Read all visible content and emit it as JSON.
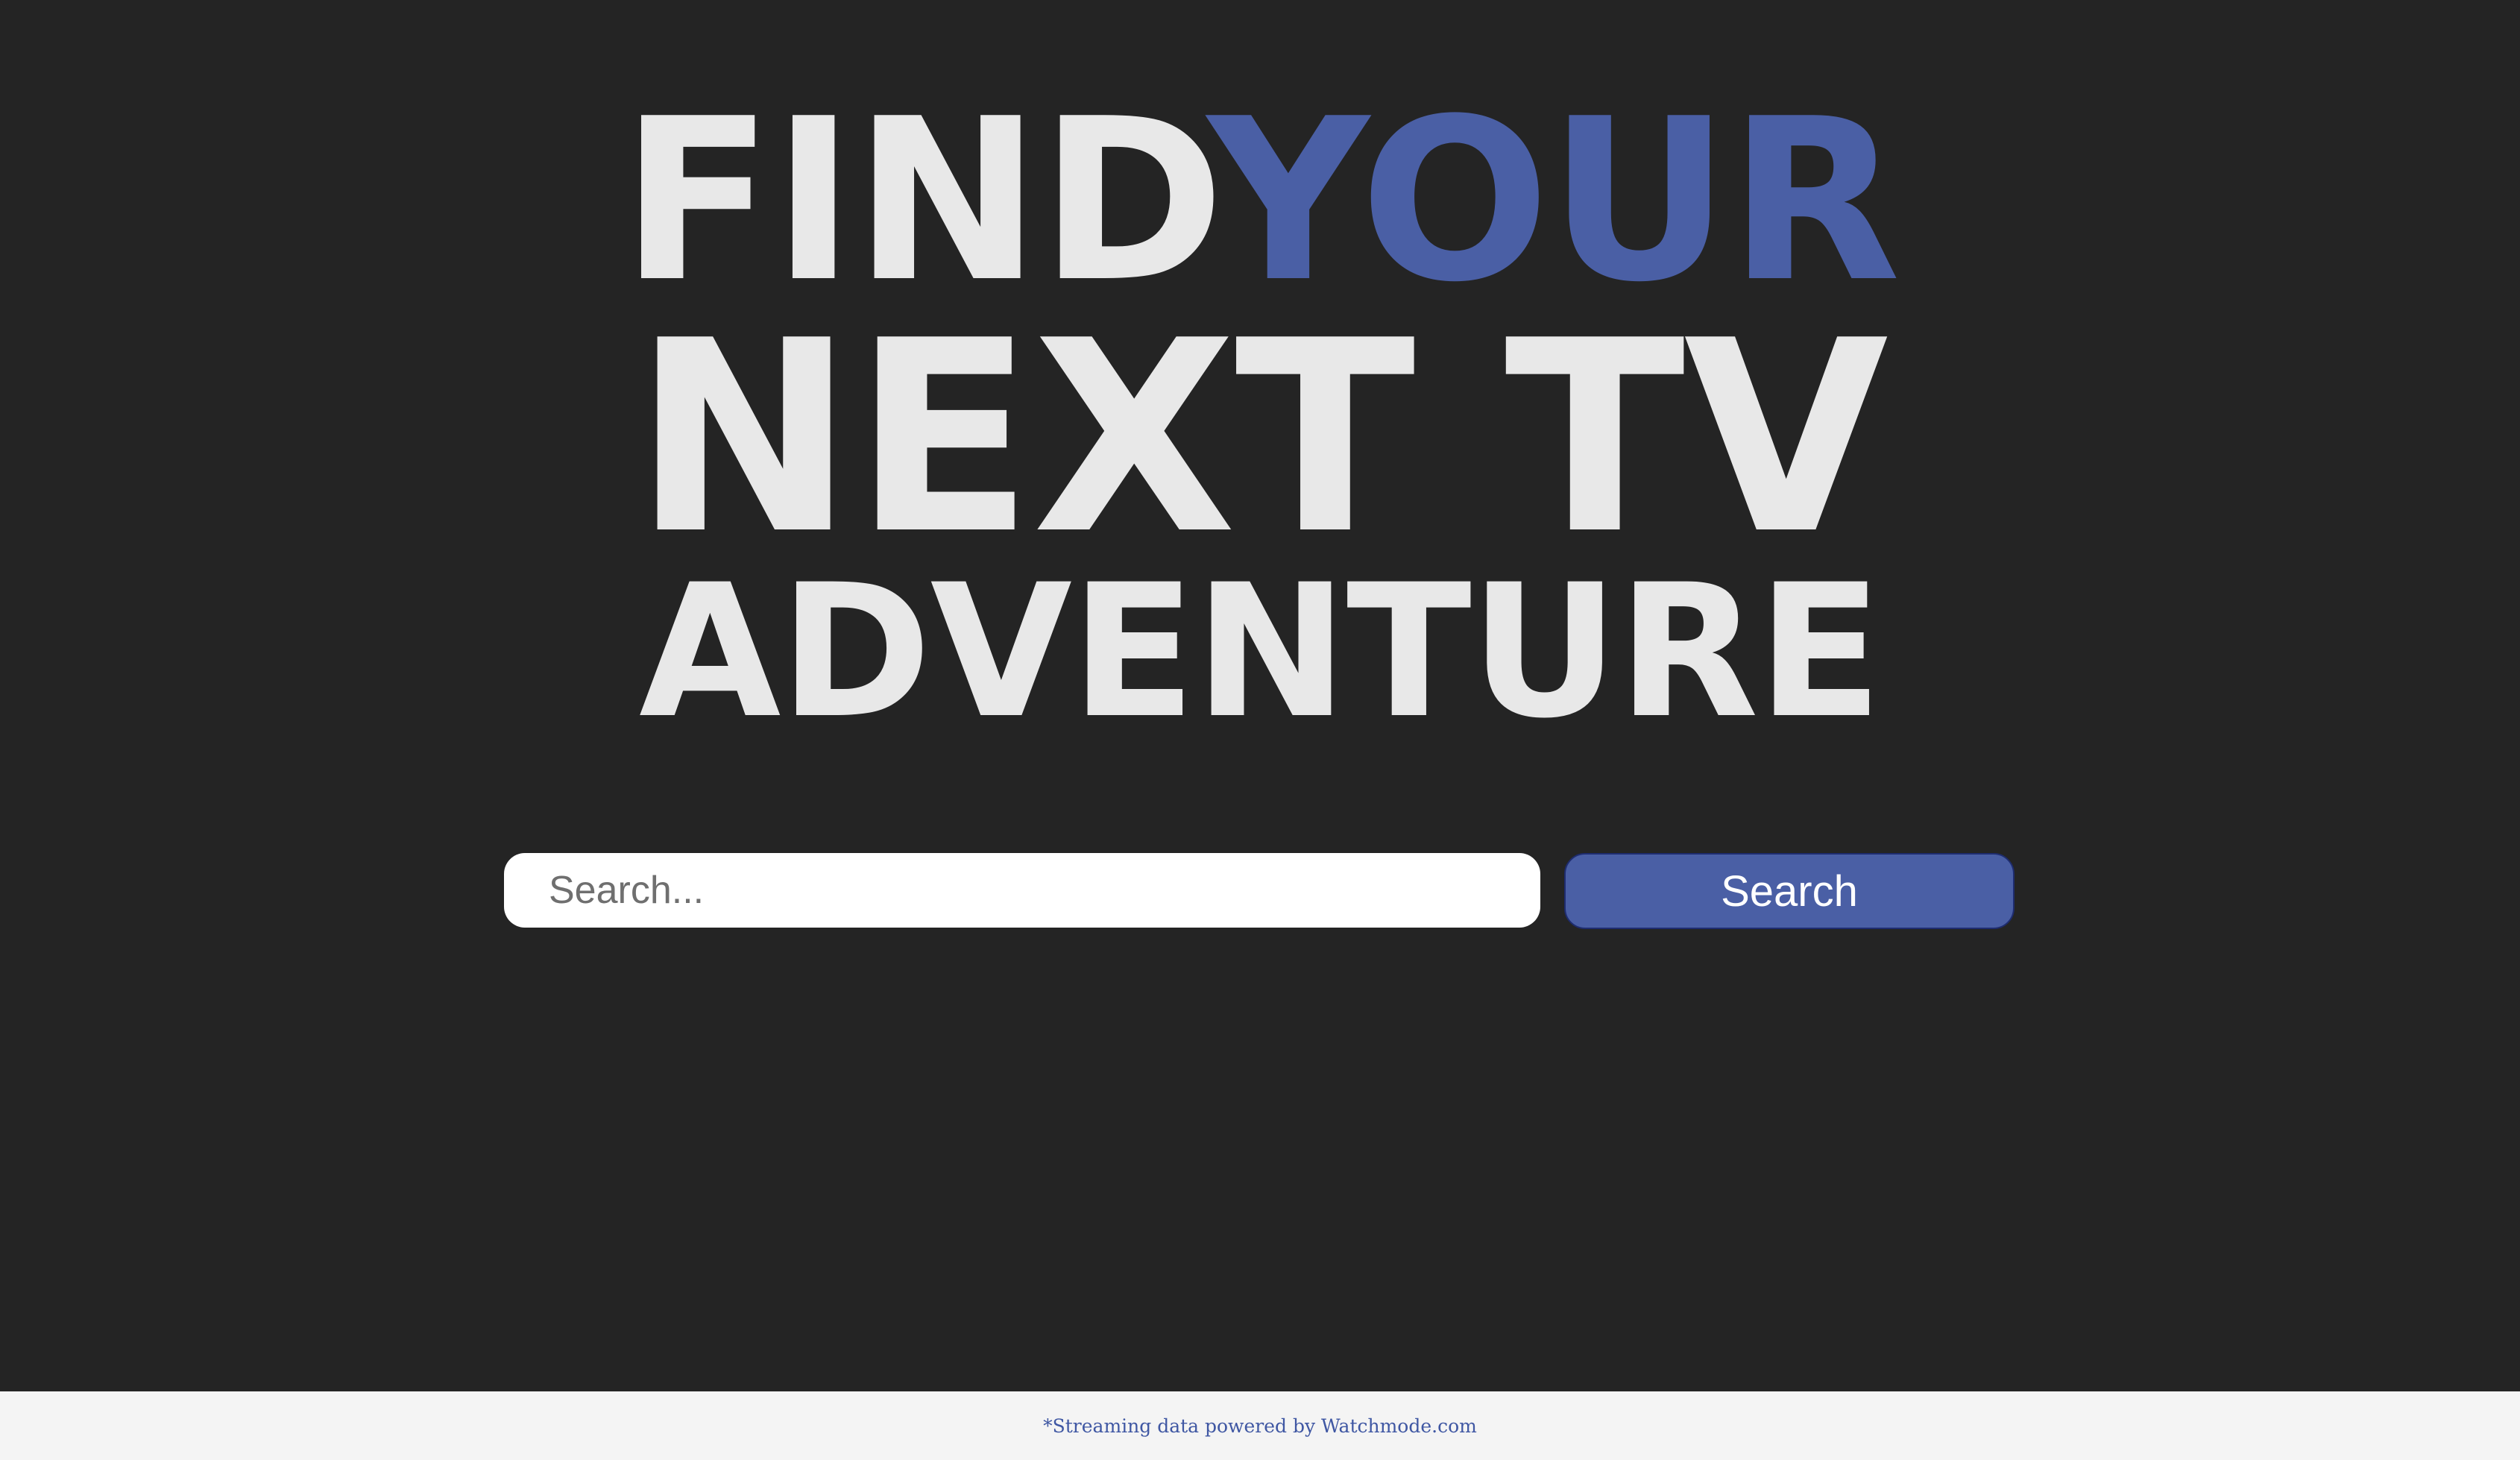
{
  "hero": {
    "line1_word1": "FIND",
    "line1_word2": "YOUR",
    "line2": "NEXT TV",
    "line3": "ADVENTURE"
  },
  "search": {
    "placeholder": "Search...",
    "value": "",
    "button_label": "Search"
  },
  "footer": {
    "text": "*Streaming data powered by Watchmode.com"
  },
  "colors": {
    "background": "#242424",
    "heading": "#e8e8e8",
    "accent": "#4a5fa5",
    "footer_bg": "#f4f4f4"
  }
}
